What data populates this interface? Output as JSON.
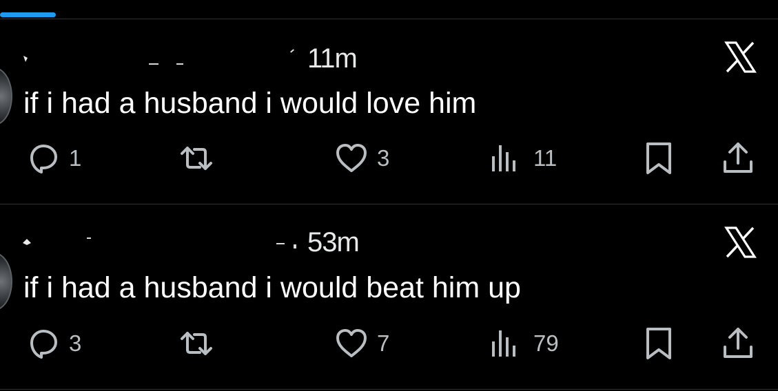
{
  "colors": {
    "background": "#000000",
    "text": "#ffffff",
    "muted": "#b9bec2",
    "divider": "#2f3336",
    "accent": "#1d9bf0"
  },
  "tweets": [
    {
      "timestamp": "11m",
      "text": "if i had a husband i would love him",
      "replies": "1",
      "likes": "3",
      "views": "11"
    },
    {
      "timestamp": "53m",
      "text": "if i had a husband i would beat him up",
      "replies": "3",
      "likes": "7",
      "views": "79"
    }
  ],
  "icons": {
    "reply": "reply-icon",
    "retweet": "retweet-icon",
    "like": "heart-icon",
    "views": "views-icon",
    "bookmark": "bookmark-icon",
    "share": "share-icon",
    "brand": "x-logo-icon"
  }
}
